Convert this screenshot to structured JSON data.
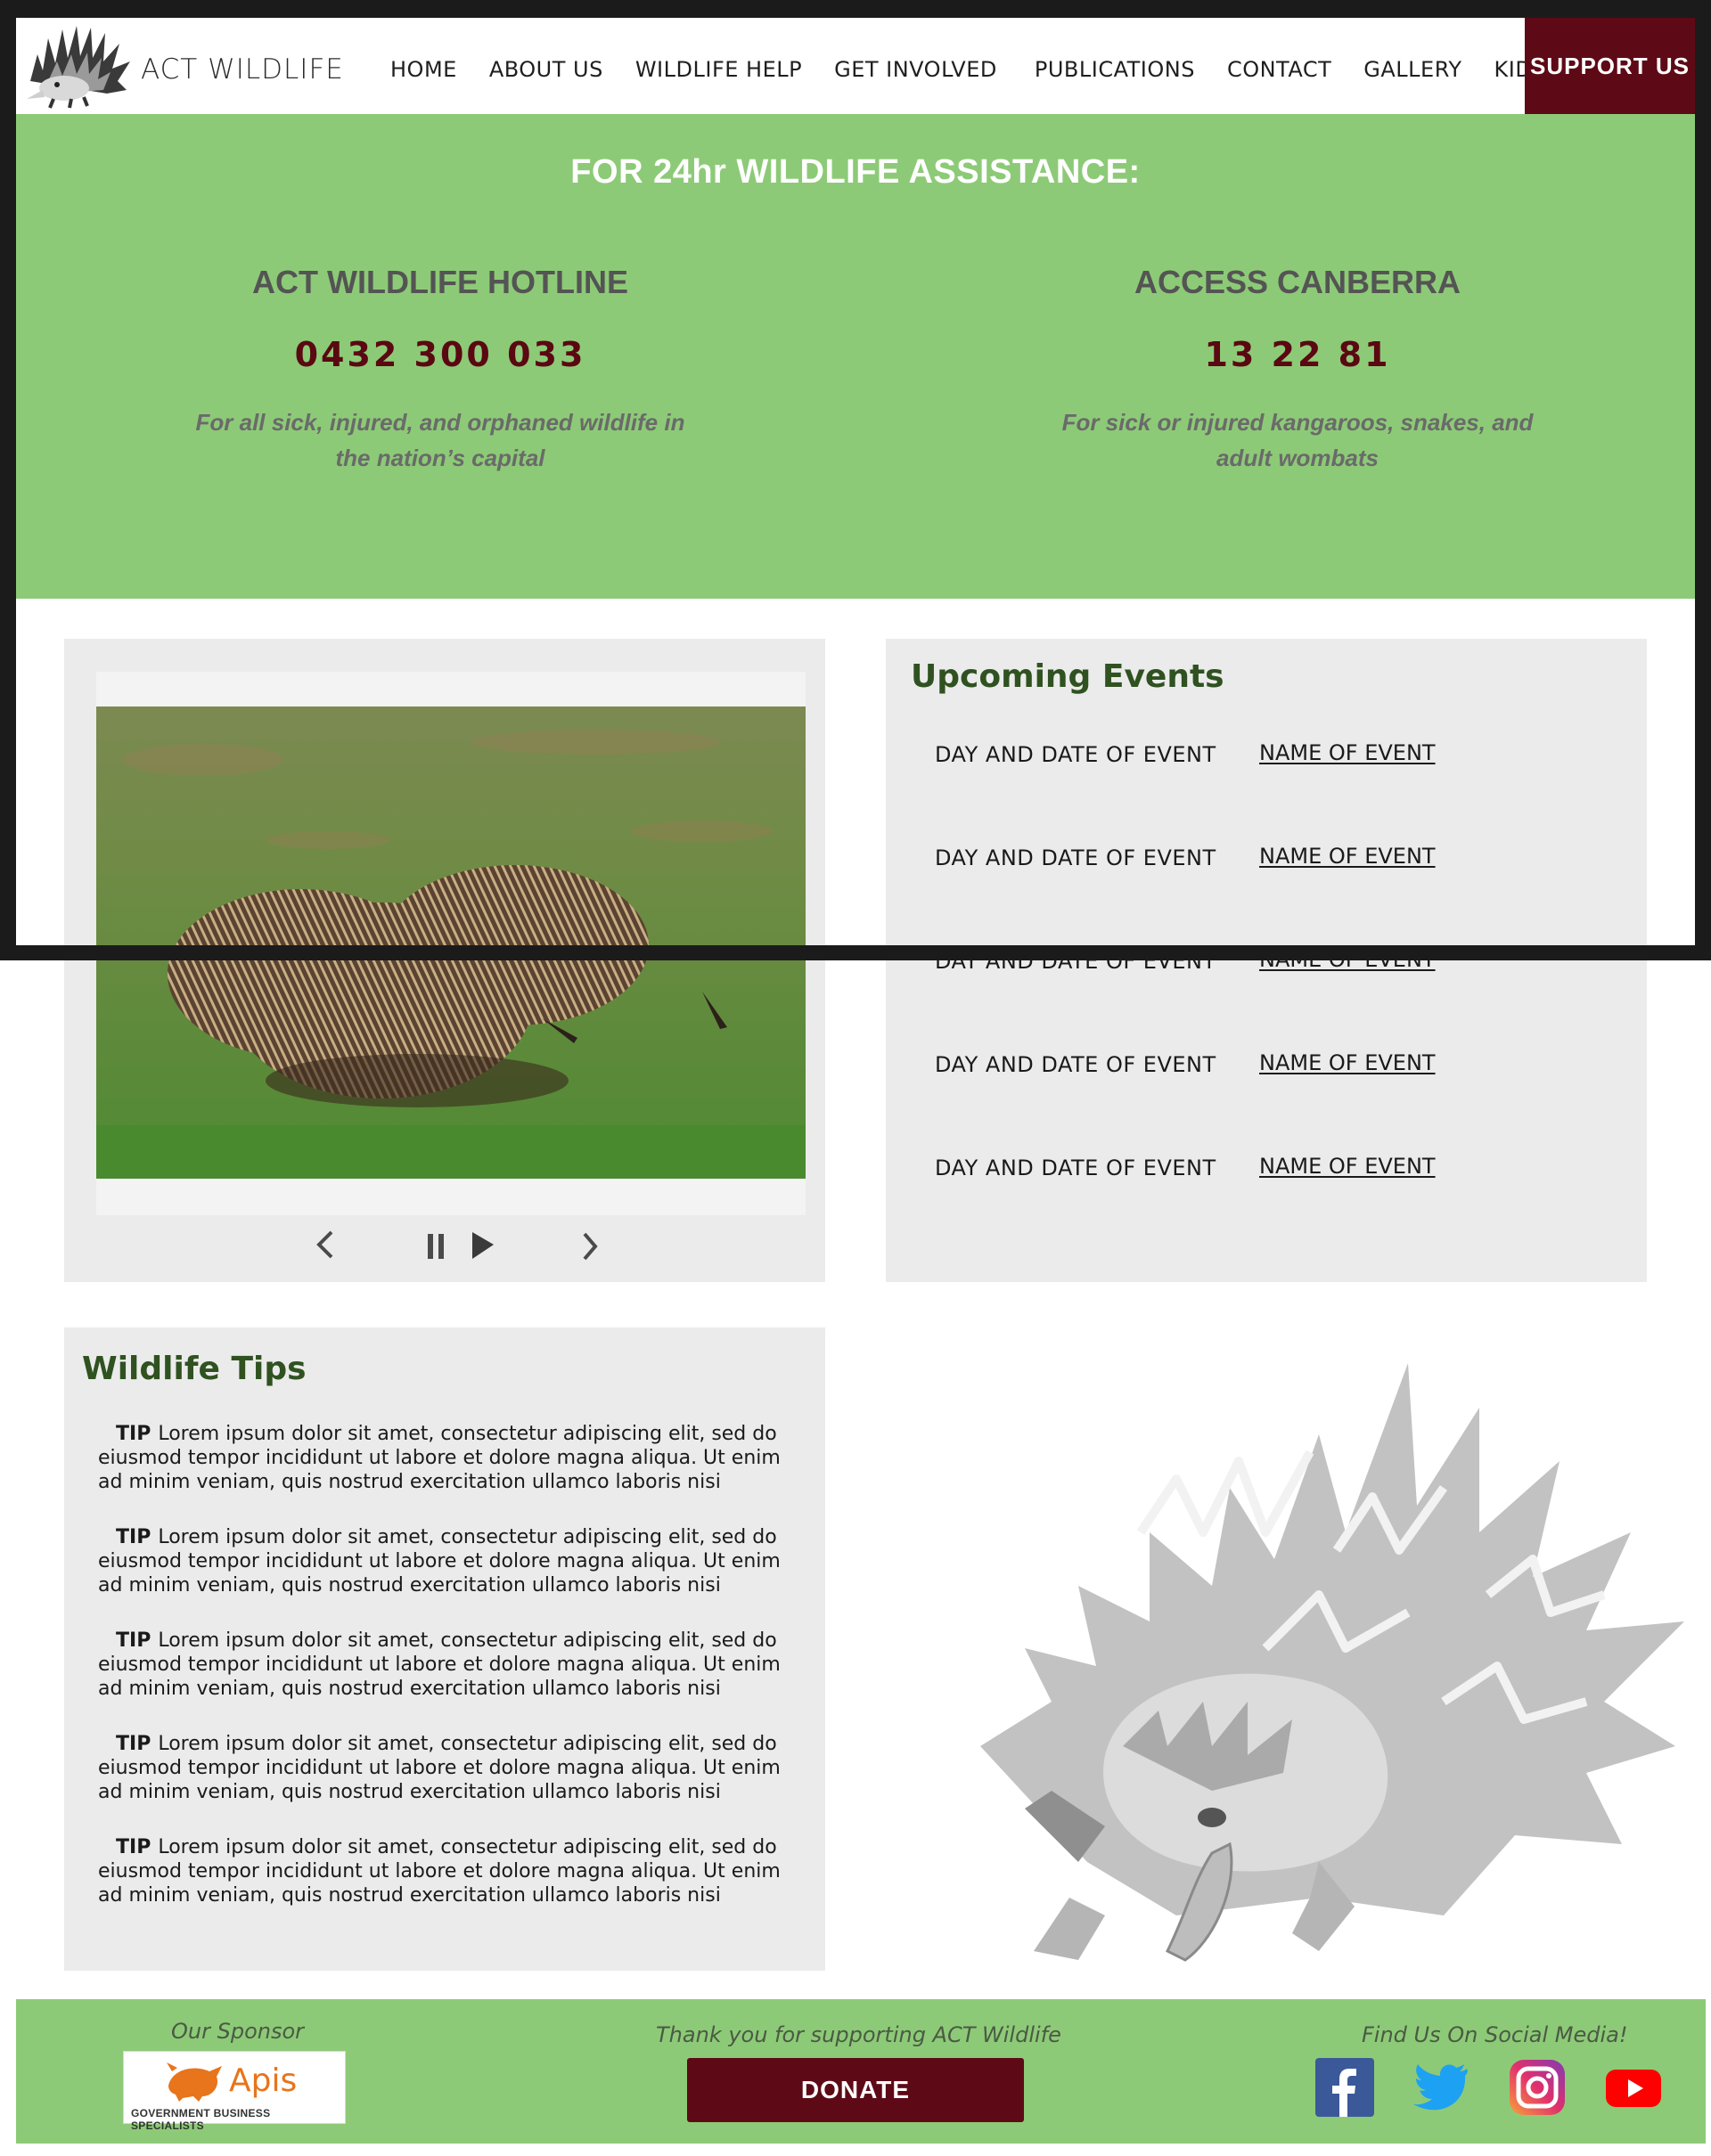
{
  "header": {
    "brand": "ACT WILDLIFE",
    "nav": [
      "HOME",
      "ABOUT US",
      "WILDLIFE HELP",
      "GET INVOLVED",
      "PUBLICATIONS",
      "CONTACT",
      "GALLERY",
      "KIDS"
    ],
    "support": "SUPPORT US"
  },
  "assist": {
    "title": "FOR 24hr WILDLIFE ASSISTANCE:",
    "hotline": {
      "name": "ACT WILDLIFE HOTLINE",
      "phone": "0432 300 033",
      "desc": "For all sick, injured, and orphaned wildlife in the nation’s capital"
    },
    "canberra": {
      "name": "ACCESS CANBERRA",
      "phone": "13 22 81",
      "desc": "For sick or injured kangaroos, snakes, and adult wombats"
    }
  },
  "slideshow": {
    "controls": [
      "chevron-left-icon",
      "pause-icon",
      "play-icon",
      "chevron-right-icon"
    ]
  },
  "events": {
    "title": "Upcoming Events",
    "items": [
      {
        "date": "DAY AND DATE OF EVENT",
        "name": "NAME OF EVENT"
      },
      {
        "date": "DAY AND DATE OF EVENT",
        "name": "NAME OF EVENT"
      },
      {
        "date": "DAY AND DATE OF EVENT",
        "name": "NAME OF EVENT"
      },
      {
        "date": "DAY AND DATE OF EVENT",
        "name": "NAME OF EVENT"
      },
      {
        "date": "DAY AND DATE OF EVENT",
        "name": "NAME OF EVENT"
      }
    ]
  },
  "tips": {
    "title": "Wildlife Tips",
    "label": "TIP",
    "items": [
      "Lorem ipsum dolor sit amet, consectetur adipiscing elit, sed do eiusmod tempor incididunt ut labore et dolore magna aliqua. Ut enim ad minim veniam, quis nostrud exercitation ullamco laboris nisi",
      "Lorem ipsum dolor sit amet, consectetur adipiscing elit, sed do eiusmod tempor incididunt ut labore et dolore magna aliqua. Ut enim ad minim veniam, quis nostrud exercitation ullamco laboris nisi",
      "Lorem ipsum dolor sit amet, consectetur adipiscing elit, sed do eiusmod tempor incididunt ut labore et dolore magna aliqua. Ut enim ad minim veniam, quis nostrud exercitation ullamco laboris nisi",
      "Lorem ipsum dolor sit amet, consectetur adipiscing elit, sed do eiusmod tempor incididunt ut labore et dolore magna aliqua. Ut enim ad minim veniam, quis nostrud exercitation ullamco laboris nisi",
      "Lorem ipsum dolor sit amet, consectetur adipiscing elit, sed do eiusmod tempor incididunt ut labore et dolore magna aliqua. Ut enim ad minim veniam, quis nostrud exercitation ullamco laboris nisi"
    ]
  },
  "footer": {
    "sponsor_caption": "Our Sponsor",
    "sponsor_name": "Apis",
    "sponsor_tagline": "GOVERNMENT BUSINESS SPECIALISTS",
    "thanks": "Thank you for supporting ACT Wildlife",
    "donate": "DONATE",
    "social_caption": "Find Us On Social Media!",
    "social": [
      "facebook-icon",
      "twitter-icon",
      "instagram-icon",
      "youtube-icon"
    ]
  },
  "colors": {
    "green": "#8dca77",
    "maroon": "#5e0a16",
    "dark_green_heading": "#2f5220",
    "panel_grey": "#ebebeb"
  }
}
